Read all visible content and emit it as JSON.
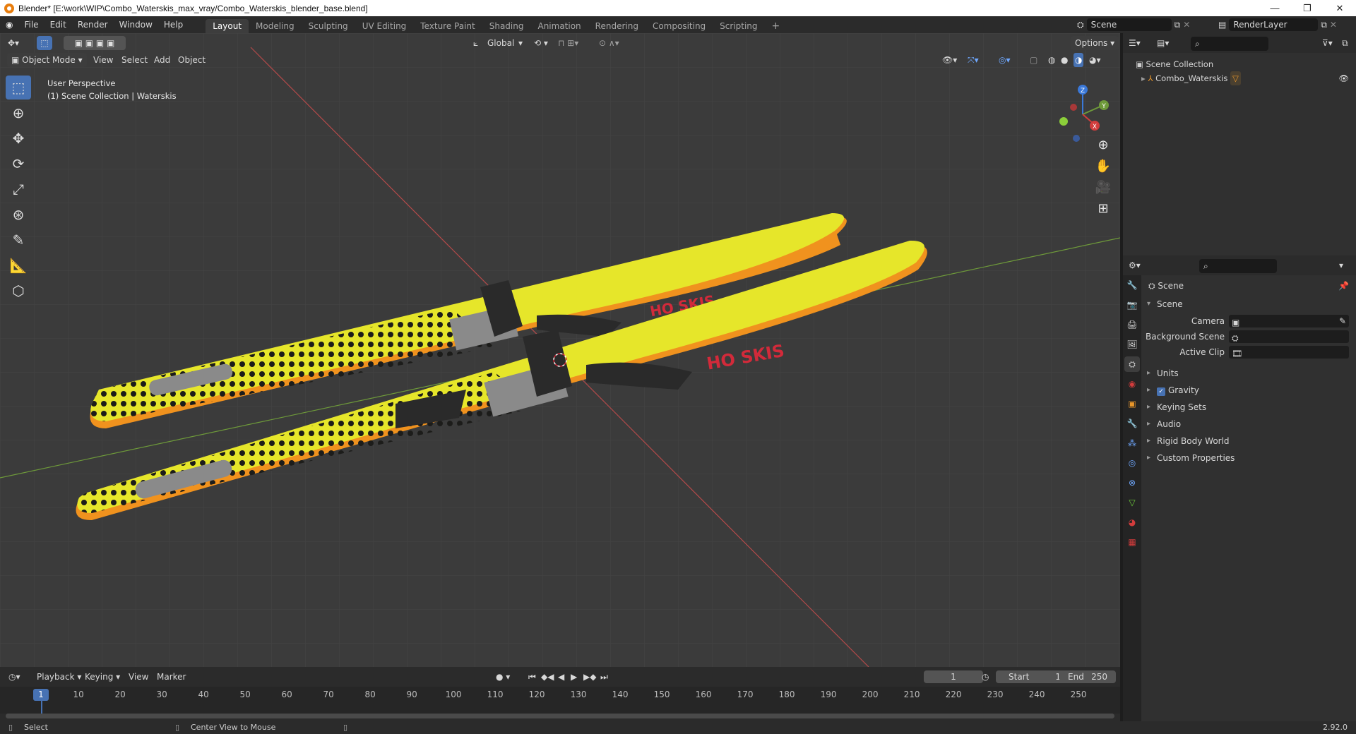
{
  "titlebar": {
    "title": "Blender* [E:\\work\\WIP\\Combo_Waterskis_max_vray/Combo_Waterskis_blender_base.blend]",
    "minimize": "—",
    "restore": "❐",
    "close": "✕"
  },
  "menu": [
    "File",
    "Edit",
    "Render",
    "Window",
    "Help"
  ],
  "workspaces": [
    "Layout",
    "Modeling",
    "Sculpting",
    "UV Editing",
    "Texture Paint",
    "Shading",
    "Animation",
    "Rendering",
    "Compositing",
    "Scripting"
  ],
  "workspace_add": "+",
  "scene_selector": {
    "value": "Scene"
  },
  "view_layer_selector": {
    "value": "RenderLayer"
  },
  "viewport": {
    "mode": "Object Mode",
    "menus": [
      "View",
      "Select",
      "Add",
      "Object"
    ],
    "transform_orientation": "Global",
    "options_label": "Options",
    "overlay_line1": "User Perspective",
    "overlay_line2": "(1) Scene Collection | Waterskis",
    "gizmo": {
      "z": "Z",
      "y": "Y",
      "x": "X"
    },
    "colors": {
      "ski_yellow": "#e6e62a",
      "ski_edge_orange": "#f0921e",
      "ski_dark": "#1c1c1a",
      "binding": "#2a2a2a",
      "plate": "#8a8a8a",
      "axis_red": "#b44a4a",
      "axis_green": "#6e9a3a",
      "logo_red": "#d22a3a",
      "logo_blue": "#2a6ec8"
    },
    "logo_text": "HO SKIS"
  },
  "timeline": {
    "menus": [
      "Playback",
      "Keying",
      "View",
      "Marker"
    ],
    "current_frame": "1",
    "start_label": "Start",
    "start_value": "1",
    "end_label": "End",
    "end_value": "250",
    "ticks": [
      "1",
      "10",
      "20",
      "30",
      "40",
      "50",
      "60",
      "70",
      "80",
      "90",
      "100",
      "110",
      "120",
      "130",
      "140",
      "150",
      "160",
      "170",
      "180",
      "190",
      "200",
      "210",
      "220",
      "230",
      "240",
      "250"
    ]
  },
  "statusbar": {
    "left": "Select",
    "middle": "Center View to Mouse",
    "version": "2.92.0"
  },
  "outliner": {
    "root": "Scene Collection",
    "items": [
      {
        "label": "Combo_Waterskis"
      }
    ]
  },
  "properties": {
    "header": "Scene",
    "open_panel": "Scene",
    "fields": [
      {
        "label": "Camera"
      },
      {
        "label": "Background Scene"
      },
      {
        "label": "Active Clip"
      }
    ],
    "panels": [
      "Units",
      "Gravity",
      "Keying Sets",
      "Audio",
      "Rigid Body World",
      "Custom Properties"
    ]
  }
}
